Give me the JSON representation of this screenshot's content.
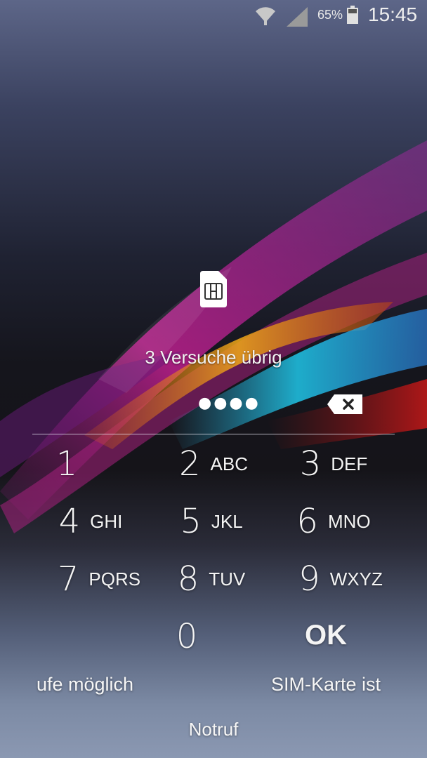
{
  "status_bar": {
    "battery_percent": "65%",
    "time": "15:45",
    "icons": [
      "wifi-icon",
      "signal-icon",
      "battery-icon"
    ]
  },
  "lock": {
    "icon": "sim-card-icon",
    "attempts_text": "3 Versuche übrig",
    "pin_mask": "●●●●"
  },
  "keypad": {
    "keys": [
      {
        "num": "1",
        "letters": ""
      },
      {
        "num": "2",
        "letters": "ABC"
      },
      {
        "num": "3",
        "letters": "DEF"
      },
      {
        "num": "4",
        "letters": "GHI"
      },
      {
        "num": "5",
        "letters": "JKL"
      },
      {
        "num": "6",
        "letters": "MNO"
      },
      {
        "num": "7",
        "letters": "PQRS"
      },
      {
        "num": "8",
        "letters": "TUV"
      },
      {
        "num": "9",
        "letters": "WXYZ"
      },
      {
        "num": "0",
        "letters": ""
      }
    ],
    "ok_label": "OK"
  },
  "footer": {
    "left_text": "ufe möglich",
    "right_text": "SIM-Karte ist",
    "emergency_label": "Notruf"
  },
  "colors": {
    "text": "#ffffff",
    "wave_magenta": "#c2188f",
    "wave_cyan": "#1fb8d8",
    "wave_orange": "#e08a12"
  }
}
